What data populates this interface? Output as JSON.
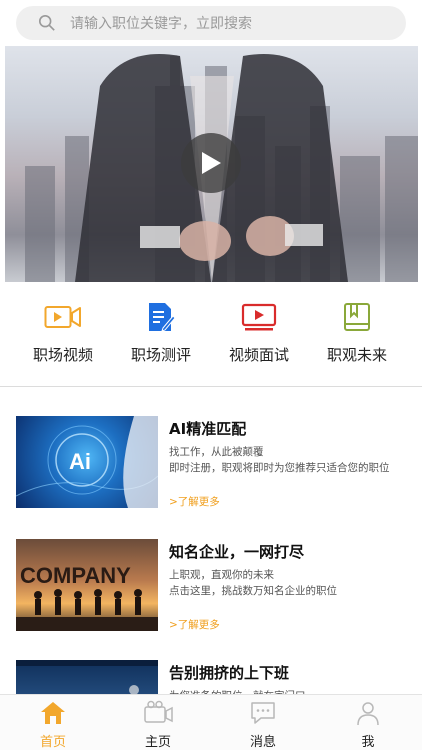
{
  "search": {
    "placeholder": "请输入职位关键字，立即搜索"
  },
  "nav": [
    {
      "label": "职场视频",
      "icon": "video-camera-icon",
      "color": "#f2a72c"
    },
    {
      "label": "职场测评",
      "icon": "document-edit-icon",
      "color": "#1f6fe0"
    },
    {
      "label": "视频面试",
      "icon": "monitor-play-icon",
      "color": "#d92b2b"
    },
    {
      "label": "职观未来",
      "icon": "book-icon",
      "color": "#8aa83a"
    }
  ],
  "cards": [
    {
      "title": "AI精准匹配",
      "line1": "找工作，从此被颠覆",
      "line2": "即时注册，职观将即时为您推荐只适合您的职位",
      "more": ">了解更多",
      "thumb_text": "Ai"
    },
    {
      "title": "知名企业，一网打尽",
      "line1": "上职观，直观你的未来",
      "line2": "点击这里，挑战数万知名企业的职位",
      "more": ">了解更多",
      "thumb_text": "COMPANY"
    },
    {
      "title": "告别拥挤的上下班",
      "line1": "为您准备的职位，就在家门口",
      "line2": "",
      "more": "",
      "thumb_text": ""
    }
  ],
  "tabs": [
    {
      "label": "首页",
      "icon": "home-icon",
      "active": true
    },
    {
      "label": "主页",
      "icon": "camera-icon",
      "active": false
    },
    {
      "label": "消息",
      "icon": "chat-bubble-icon",
      "active": false
    },
    {
      "label": "我",
      "icon": "user-icon",
      "active": false
    }
  ],
  "colors": {
    "accent": "#f2a72c",
    "link": "#f0a020"
  }
}
